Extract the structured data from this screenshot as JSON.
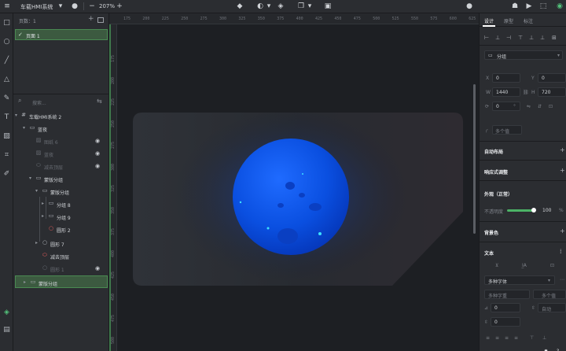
{
  "topbar": {
    "project_title": "车载HMI系统",
    "zoom": "207%"
  },
  "layers_panel": {
    "pages_label": "页数：1",
    "pages": [
      {
        "name": "页面 1"
      }
    ],
    "search_placeholder": "搜索...",
    "tree": [
      {
        "name": "车载HMI系统 2",
        "level": 0,
        "icon": "frame-icon",
        "caret": "▾"
      },
      {
        "name": "蓝夜",
        "level": 1,
        "icon": "folder-icon",
        "caret": "▾"
      },
      {
        "name": "图纸 6",
        "level": 2,
        "icon": "image-icon",
        "dim": true,
        "eye": true
      },
      {
        "name": "蓝夜",
        "level": 2,
        "icon": "image-icon",
        "dim": true,
        "eye": true
      },
      {
        "name": "减去顶层",
        "level": 2,
        "icon": "shape-icon",
        "dim": true,
        "eye": true
      },
      {
        "name": "蒙版分组",
        "level": 1,
        "icon": "folder-icon",
        "caret": "▾"
      },
      {
        "name": "蒙版分组",
        "level": 2,
        "icon": "folder-icon",
        "caret": "▾"
      },
      {
        "name": "分组 8",
        "level": 3,
        "icon": "folder-icon",
        "caret": "▸"
      },
      {
        "name": "分组 9",
        "level": 3,
        "icon": "folder-icon",
        "caret": "▸"
      },
      {
        "name": "圆形 2",
        "level": 3,
        "icon": "circle-red-icon"
      },
      {
        "name": "圆形 7",
        "level": 2,
        "icon": "circle-icon",
        "caret": "▸"
      },
      {
        "name": "减去顶层",
        "level": 2,
        "icon": "shape-red-icon"
      },
      {
        "name": "圆形 1",
        "level": 2,
        "icon": "circle-icon",
        "dim": true,
        "eye": true
      },
      {
        "name": "蒙版分组",
        "level": 1,
        "icon": "folder-icon",
        "caret": "▸",
        "selected": true
      }
    ]
  },
  "ruler": {
    "top": [
      "175",
      "200",
      "225",
      "250",
      "275",
      "300",
      "325",
      "350",
      "375",
      "400",
      "425",
      "450",
      "475",
      "500",
      "525",
      "550",
      "575",
      "600",
      "625"
    ],
    "left": [
      "175",
      "200",
      "225",
      "250",
      "275",
      "300",
      "325",
      "350",
      "375",
      "400",
      "425",
      "450",
      "475",
      "500"
    ]
  },
  "props_panel": {
    "tabs": [
      "设计",
      "原型",
      "标注"
    ],
    "layer_type": "分组",
    "x_label": "X",
    "x_value": "0",
    "y_label": "Y",
    "y_value": "0",
    "w_label": "W",
    "w_value": "1440",
    "h_label": "H",
    "h_value": "720",
    "rotation_value": "0",
    "rotation_unit": "°",
    "radius_placeholder": "多个值",
    "auto_layout": "自动布局",
    "responsive": "响应式调整",
    "appearance": "外观（正常）",
    "opacity_label": "不透明度",
    "opacity_value": "100",
    "opacity_unit": "%",
    "fill": "背景色",
    "text": "文本",
    "font_family": "多种字体",
    "font_weight": "多种字重",
    "font_size": "多个值",
    "letter_spacing": "0",
    "line_height": "0",
    "auto": "自动",
    "paragraph": "0"
  },
  "colors": {
    "accent_green": "#4bb366",
    "planet_blue": "#0a4fe0",
    "artboard_gray": "#2c2f36"
  }
}
